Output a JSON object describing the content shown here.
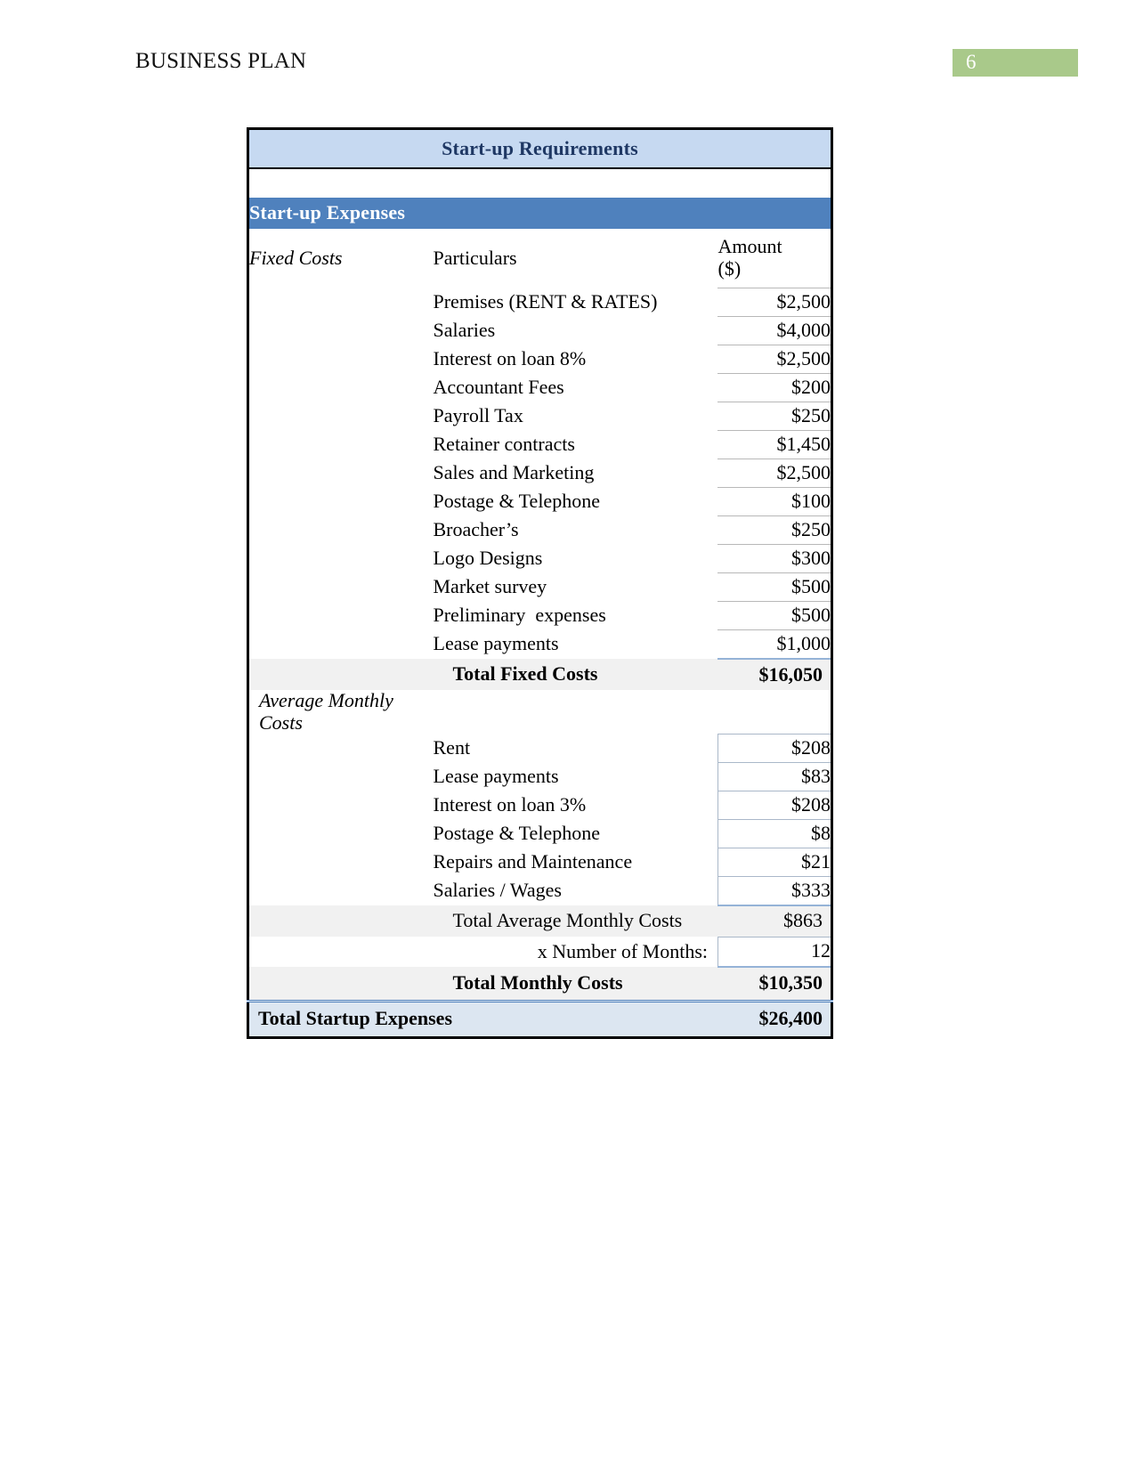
{
  "header": {
    "doc_title": "BUSINESS PLAN",
    "page_number": "6",
    "badge_color": "#a9c98a"
  },
  "table": {
    "title": "Start-up Requirements",
    "section_band": "Start-up Expenses",
    "colors": {
      "title_bg": "#c6d9f1",
      "title_text": "#1f3864",
      "band_bg": "#4f81bd",
      "band_text": "#ffffff",
      "subtotal_bg": "#f1f1f1",
      "grand_bg": "#dce6f1",
      "rule": "#95b3d7"
    },
    "fixed": {
      "group_label": "Fixed Costs",
      "col_particulars": "Particulars",
      "col_amount": "Amount ($)",
      "rows": [
        {
          "label": "Premises (RENT & RATES)",
          "amount": "$2,500"
        },
        {
          "label": "Salaries",
          "amount": "$4,000"
        },
        {
          "label": "Interest on loan 8%",
          "amount": "$2,500"
        },
        {
          "label": "Accountant Fees",
          "amount": "$200"
        },
        {
          "label": "Payroll Tax",
          "amount": "$250"
        },
        {
          "label": "Retainer contracts",
          "amount": "$1,450"
        },
        {
          "label": "Sales and Marketing",
          "amount": "$2,500"
        },
        {
          "label": "Postage & Telephone",
          "amount": "$100"
        },
        {
          "label": "Broacher’s",
          "amount": "$250"
        },
        {
          "label": "Logo Designs",
          "amount": "$300"
        },
        {
          "label": "Market survey",
          "amount": "$500"
        },
        {
          "label": "Preliminary  expenses",
          "amount": "$500"
        },
        {
          "label": "Lease payments",
          "amount": "$1,000"
        }
      ],
      "total_label": "Total Fixed Costs",
      "total_amount": "$16,050"
    },
    "monthly": {
      "group_label": "Average Monthly Costs",
      "rows": [
        {
          "label": "Rent",
          "amount": "$208"
        },
        {
          "label": "Lease payments",
          "amount": "$83"
        },
        {
          "label": "Interest on loan 3%",
          "amount": "$208"
        },
        {
          "label": "Postage & Telephone",
          "amount": "$8"
        },
        {
          "label": "Repairs and Maintenance",
          "amount": "$21"
        },
        {
          "label": "Salaries / Wages",
          "amount": "$333"
        }
      ],
      "subtotal_label": "Total Average Monthly Costs",
      "subtotal_amount": "$863",
      "months_label": "x Number of Months:",
      "months_value": "12",
      "total_label": "Total Monthly Costs",
      "total_amount": "$10,350"
    },
    "grand_total": {
      "label": "Total Startup Expenses",
      "amount": "$26,400"
    }
  }
}
